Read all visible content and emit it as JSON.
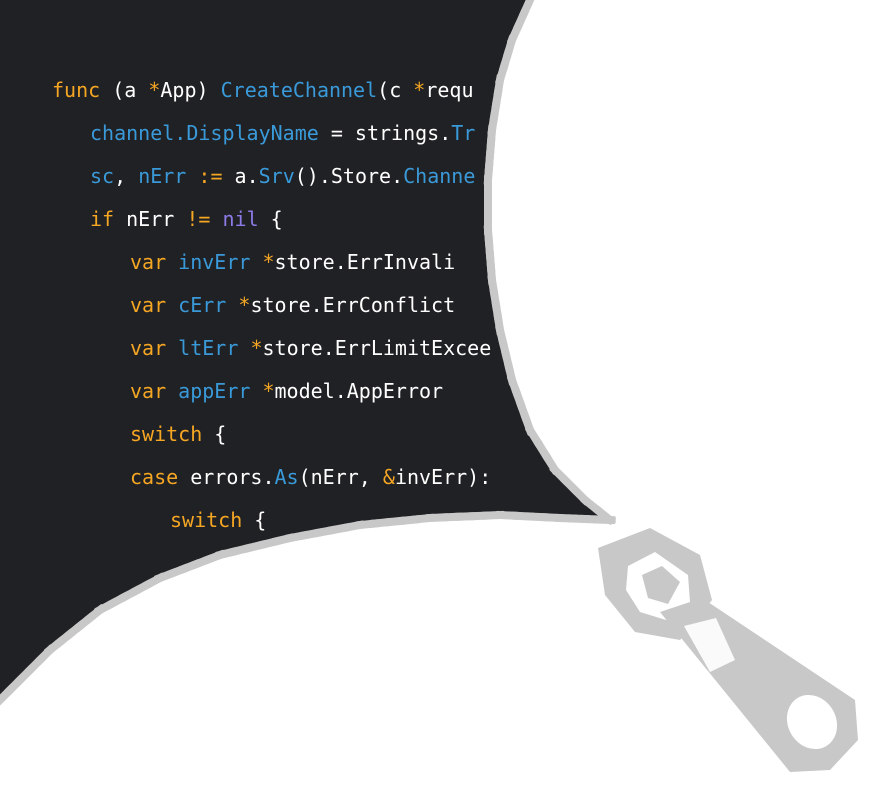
{
  "code": {
    "lines": [
      {
        "tokens": [
          {
            "t": "func",
            "c": "kw"
          },
          {
            "t": " (a "
          },
          {
            "t": "*",
            "c": "kw"
          },
          {
            "t": "App) "
          },
          {
            "t": "CreateChannel",
            "c": "fn"
          },
          {
            "t": "(c "
          },
          {
            "t": "*",
            "c": "kw"
          },
          {
            "t": "requ"
          }
        ]
      },
      {
        "tokens": [
          {
            "t": "channel.",
            "c": "fn"
          },
          {
            "t": "DisplayName",
            "c": "fn"
          },
          {
            "t": " = strings."
          },
          {
            "t": "Tr",
            "c": "fn"
          }
        ]
      },
      {
        "tokens": [
          {
            "t": "sc",
            "c": "fn"
          },
          {
            "t": ", "
          },
          {
            "t": "nErr",
            "c": "fn"
          },
          {
            "t": " "
          },
          {
            "t": ":=",
            "c": "kw"
          },
          {
            "t": " a."
          },
          {
            "t": "Srv",
            "c": "fn"
          },
          {
            "t": "().Store."
          },
          {
            "t": "Channe",
            "c": "fn"
          }
        ]
      },
      {
        "tokens": [
          {
            "t": "if",
            "c": "kw"
          },
          {
            "t": " nErr "
          },
          {
            "t": "!=",
            "c": "kw"
          },
          {
            "t": " "
          },
          {
            "t": "nil",
            "c": "pu"
          },
          {
            "t": " {"
          }
        ]
      },
      {
        "tokens": [
          {
            "t": "var",
            "c": "kw"
          },
          {
            "t": " "
          },
          {
            "t": "invErr",
            "c": "fn"
          },
          {
            "t": " "
          },
          {
            "t": "*",
            "c": "kw"
          },
          {
            "t": "store.ErrInvali"
          }
        ]
      },
      {
        "tokens": [
          {
            "t": "var",
            "c": "kw"
          },
          {
            "t": " "
          },
          {
            "t": "cErr",
            "c": "fn"
          },
          {
            "t": " "
          },
          {
            "t": "*",
            "c": "kw"
          },
          {
            "t": "store.ErrConflict"
          }
        ]
      },
      {
        "tokens": [
          {
            "t": "var",
            "c": "kw"
          },
          {
            "t": " "
          },
          {
            "t": "ltErr",
            "c": "fn"
          },
          {
            "t": " "
          },
          {
            "t": "*",
            "c": "kw"
          },
          {
            "t": "store.ErrLimitExcee"
          }
        ]
      },
      {
        "tokens": [
          {
            "t": "var",
            "c": "kw"
          },
          {
            "t": " "
          },
          {
            "t": "appErr",
            "c": "fn"
          },
          {
            "t": " "
          },
          {
            "t": "*",
            "c": "kw"
          },
          {
            "t": "model.AppError"
          }
        ]
      },
      {
        "tokens": [
          {
            "t": "switch",
            "c": "kw"
          },
          {
            "t": " {"
          }
        ]
      },
      {
        "tokens": [
          {
            "t": "case",
            "c": "kw"
          },
          {
            "t": " errors."
          },
          {
            "t": "As",
            "c": "fn"
          },
          {
            "t": "(nErr, "
          },
          {
            "t": "&",
            "c": "kw"
          },
          {
            "t": "invErr):"
          }
        ]
      },
      {
        "tokens": [
          {
            "t": "switch",
            "c": "kw"
          },
          {
            "t": " {"
          }
        ]
      }
    ]
  },
  "colors": {
    "background_dark": "#202124",
    "keyword": "#f5a623",
    "identifier": "#3a9ad9",
    "literal": "#8c7ae6",
    "zipper": "#c8c8c8"
  },
  "icons": [
    "zipper-teeth",
    "zipper-slider-icon",
    "zipper-pull-tab-icon"
  ]
}
